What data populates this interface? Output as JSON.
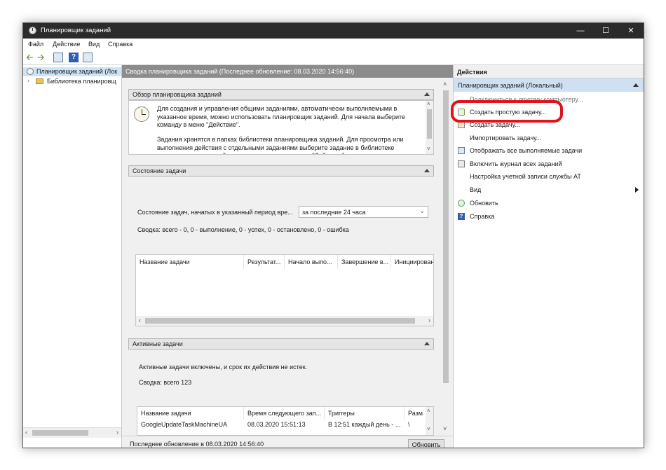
{
  "window": {
    "title": "Планировщик заданий"
  },
  "menu": [
    "Файл",
    "Действие",
    "Вид",
    "Справка"
  ],
  "tree": {
    "items": [
      {
        "label": "Планировщик заданий (Лок"
      },
      {
        "label": "Библиотека планировщ"
      }
    ]
  },
  "center": {
    "header": "Сводка планировщика заданий (Последнее обновление: 08.03.2020 14:56:40)",
    "overview": {
      "title": "Обзор планировщика заданий",
      "para1": "Для создания и управления общими заданиями, автоматически выполняемыми в указанное время, можно использовать планировщик заданий. Для начала выберите команду в меню \"Действие\".",
      "para2": "Задания хранятся в папках библиотеки планировщика заданий. Для просмотра или выполнения действия с отдельными заданиями выберите задание в библиотеке планировщика заданий и щелкните команду в меню \"Действие\"."
    },
    "status": {
      "title": "Состояние задачи",
      "filter_label": "Состояние задач, начатых в указанный период вре...",
      "filter_value": "за последние 24 часа",
      "summary": "Сводка: всего - 0, 0 - выполнение, 0 - успех, 0 - остановлено, 0 - ошибка",
      "columns": [
        "Название задачи",
        "Результат...",
        "Начало выпо...",
        "Завершение в...",
        "Инициирован"
      ]
    },
    "active": {
      "title": "Активные задачи",
      "note": "Активные задачи включены, и срок их действия не истек.",
      "summary": "Сводка: всего 123",
      "columns": [
        "Название задачи",
        "Время следующего зап...",
        "Триггеры",
        "Разм"
      ],
      "rows": [
        [
          "GoogleUpdateTaskMachineUA",
          "08.03.2020 15:51:13",
          "В 12:51 каждый день - ...",
          "\\"
        ]
      ]
    },
    "footer": {
      "last_update": "Последнее обновление в 08.03.2020 14:56:40",
      "refresh_button": "Обновить"
    }
  },
  "actions": {
    "header": "Действия",
    "group": "Планировщик заданий (Локальный)",
    "items": [
      "Подключиться к другому компьютеру...",
      "Создать простую задачу...",
      "Создать задачу...",
      "Импортировать задачу...",
      "Отображать все выполняемые задачи",
      "Включить журнал всех заданий",
      "Настройка учетной записи службы AT",
      "Вид",
      "Обновить",
      "Справка"
    ]
  },
  "colors": {
    "highlight_ring": "#e0141b",
    "titlebar": "#2b2b2b",
    "selection": "#cce4f7"
  }
}
